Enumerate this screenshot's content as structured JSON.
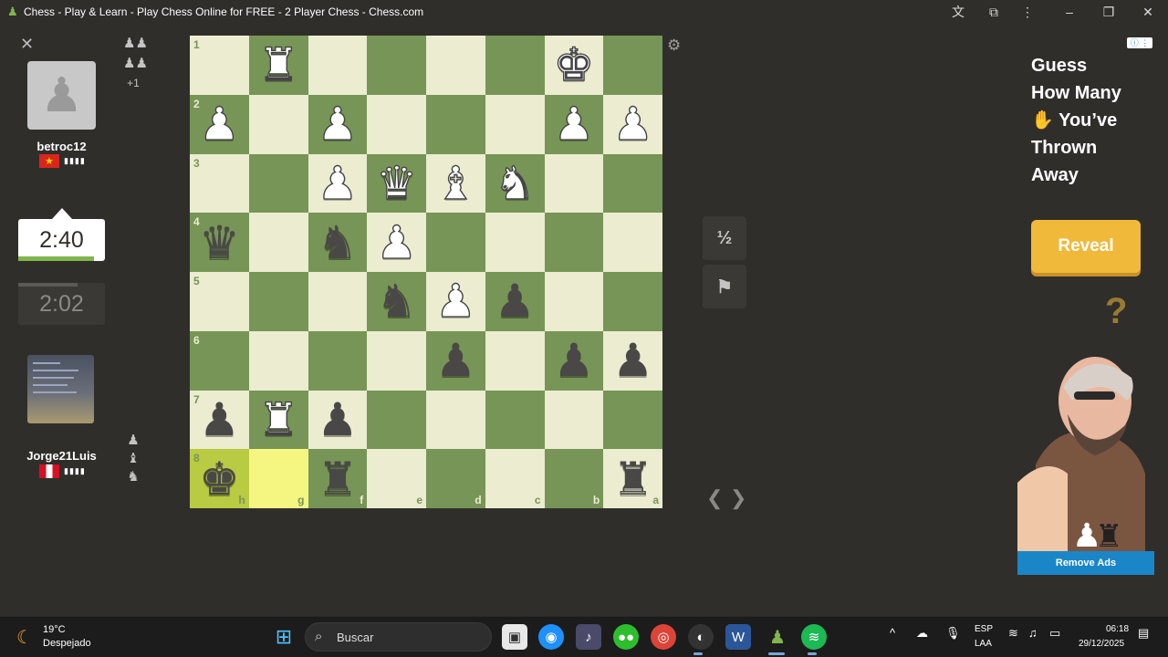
{
  "window": {
    "title": "Chess - Play & Learn - Play Chess Online for FREE - 2 Player Chess - Chess.com",
    "icons": [
      "translate-icon",
      "extensions-icon",
      "more-icon",
      "minimize-icon",
      "maximize-icon",
      "close-icon"
    ]
  },
  "top_player": {
    "name": "betroc12",
    "flag": "Vietnam",
    "flag_color": "#da251d",
    "clock": "2:40",
    "captured_extra": "+1"
  },
  "bottom_player": {
    "name": "Jorge21Luis",
    "flag": "Peru",
    "flag_color": "#d91023",
    "clock": "2:02"
  },
  "board": {
    "light_color": "#ebecd0",
    "dark_color": "#779556",
    "highlight_color": "#f5f682",
    "ranks": [
      "1",
      "2",
      "3",
      "4",
      "5",
      "6",
      "7",
      "8"
    ],
    "files": [
      "h",
      "g",
      "f",
      "e",
      "d",
      "c",
      "b",
      "a"
    ],
    "rows": [
      [
        "",
        "wR",
        "",
        "",
        "",
        "",
        "wK",
        ""
      ],
      [
        "wP",
        "",
        "wP",
        "",
        "",
        "",
        "wP",
        "wP"
      ],
      [
        "",
        "",
        "wP",
        "wQ",
        "wB",
        "wN",
        "",
        ""
      ],
      [
        "bQ",
        "",
        "bN",
        "wP",
        "",
        "",
        "",
        ""
      ],
      [
        "",
        "",
        "",
        "bN",
        "wP",
        "bP",
        "",
        ""
      ],
      [
        "",
        "",
        "",
        "",
        "bP",
        "",
        "bP",
        "bP"
      ],
      [
        "bP",
        "wR",
        "bP",
        "",
        "",
        "",
        "",
        ""
      ],
      [
        "bK",
        "",
        "bR",
        "",
        "",
        "",
        "",
        "bR"
      ]
    ],
    "highlighted": [
      "8-h",
      "8-g"
    ]
  },
  "controls": {
    "draw_label": "½",
    "resign_icon": "flag-icon",
    "prev_icon": "chevron-left-icon",
    "next_icon": "chevron-right-icon"
  },
  "ad": {
    "headline_lines": [
      "Guess",
      "How Many",
      "You’ve",
      "Thrown",
      "Away"
    ],
    "hand_icon": "hand-icon",
    "button": "Reveal",
    "question": "?",
    "remove_ads": "Remove Ads",
    "accent": "#f0b93a",
    "remove_color": "#1a86c8"
  },
  "taskbar": {
    "weather_temp": "19°C",
    "weather_desc": "Despejado",
    "search_placeholder": "Buscar",
    "lang_line1": "ESP",
    "lang_line2": "LAA",
    "time": "06:18",
    "date": "29/12/2025"
  }
}
